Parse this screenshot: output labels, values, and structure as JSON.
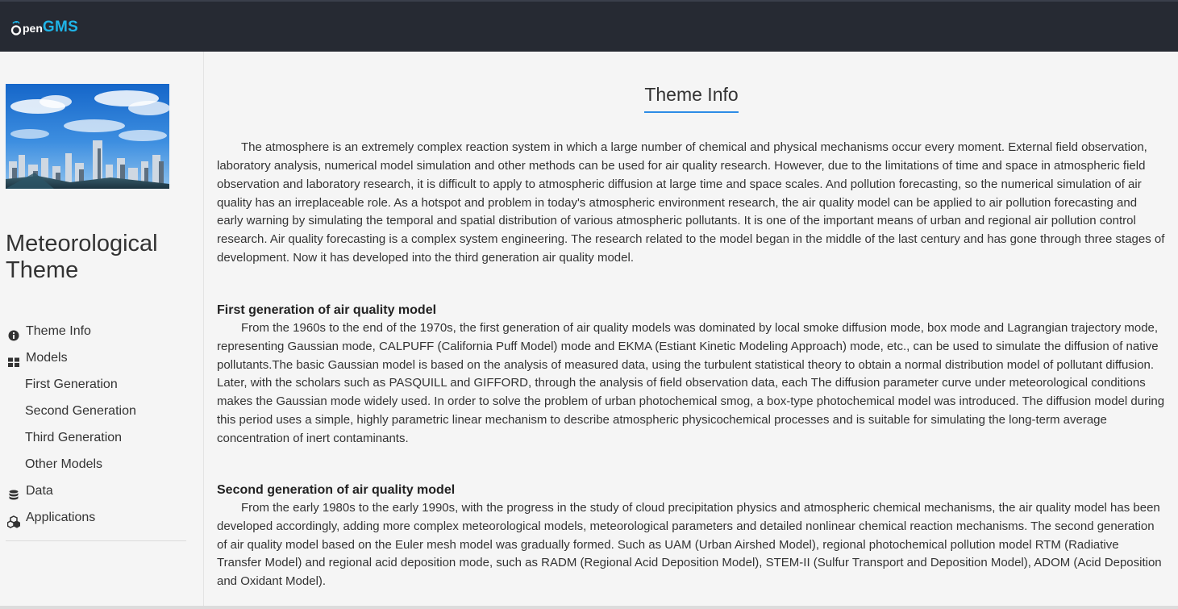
{
  "header": {
    "logo": {
      "o": "O",
      "pen": "pen",
      "gms": "GMS"
    },
    "colors": {
      "bar": "#262a33",
      "logo_accent": "#1fb5e8"
    }
  },
  "sidebar": {
    "image": "city-skyline-under-blue-sky",
    "title": "Meteorological Theme",
    "nav": [
      {
        "label": "Theme Info",
        "icon": "info-circle-icon",
        "level": 1
      },
      {
        "label": "Models",
        "icon": "grid-icon",
        "level": 1
      },
      {
        "label": "First Generation",
        "icon": "",
        "level": 2
      },
      {
        "label": "Second Generation",
        "icon": "",
        "level": 2
      },
      {
        "label": "Third Generation",
        "icon": "",
        "level": 2
      },
      {
        "label": "Other Models",
        "icon": "",
        "level": 2
      },
      {
        "label": "Data",
        "icon": "database-icon",
        "level": 1
      },
      {
        "label": "Applications",
        "icon": "cubes-icon",
        "level": 1
      }
    ]
  },
  "main": {
    "title": "Theme Info",
    "title_underline_color": "#2d8ce6",
    "intro": "The atmosphere is an extremely complex reaction system in which a large number of chemical and physical mechanisms occur every moment. External field observation, laboratory analysis, numerical model simulation and other methods can be used for air quality research. However, due to the limitations of time and space in atmospheric field observation and laboratory research, it is difficult to apply to atmospheric diffusion at large time and space scales. And pollution forecasting, so the numerical simulation of air quality has an irreplaceable role. As a hotspot and problem in today's atmospheric environment research, the air quality model can be applied to air pollution forecasting and early warning by simulating the temporal and spatial distribution of various atmospheric pollutants. It is one of the important means of urban and regional air pollution control research. Air quality forecasting is a complex system engineering. The research related to the model began in the middle of the last century and has gone through three stages of development. Now it has developed into the third generation air quality model.",
    "sections": [
      {
        "heading": "First generation of air quality model",
        "body": "From the 1960s to the end of the 1970s, the first generation of air quality models was dominated by local smoke diffusion mode, box mode and Lagrangian trajectory mode, representing Gaussian mode, CALPUFF (California Puff Model) mode and EKMA (Estiant Kinetic Modeling Approach) mode, etc., can be used to simulate the diffusion of native pollutants.The basic Gaussian model is based on the analysis of measured data, using the turbulent statistical theory to obtain a normal distribution model of pollutant diffusion. Later, with the scholars such as PASQUILL and GIFFORD, through the analysis of field observation data, each The diffusion parameter curve under meteorological conditions makes the Gaussian mode widely used. In order to solve the problem of urban photochemical smog, a box-type photochemical model was introduced. The diffusion model during this period uses a simple, highly parametric linear mechanism to describe atmospheric physicochemical processes and is suitable for simulating the long-term average concentration of inert contaminants."
      },
      {
        "heading": "Second generation of air quality model",
        "body": "From the early 1980s to the early 1990s, with the progress in the study of cloud precipitation physics and atmospheric chemical mechanisms, the air quality model has been developed accordingly, adding more complex meteorological models, meteorological parameters and detailed nonlinear chemical reaction mechanisms. The second generation of air quality model based on the Euler mesh model was gradually formed. Such as UAM (Urban Airshed Model), regional photochemical pollution model RTM (Radiative Transfer Model) and regional acid deposition mode, such as RADM (Regional Acid Deposition Model), STEM-II (Sulfur Transport and Deposition Model), ADOM (Acid Deposition and Oxidant Model)."
      }
    ]
  }
}
